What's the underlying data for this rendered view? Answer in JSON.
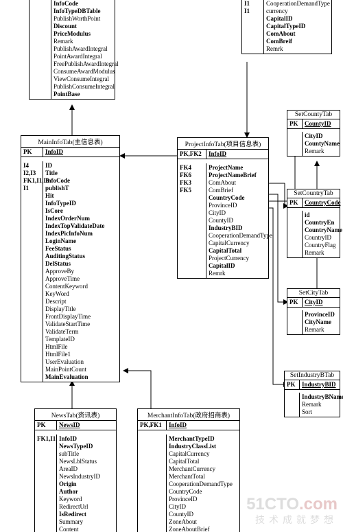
{
  "watermark": {
    "logo_a": "51CTO",
    "logo_b": ".com",
    "sub": "技术成就梦想"
  },
  "tables": {
    "topLeft": {
      "pk": "",
      "fields": [
        {
          "t": "InfoCode",
          "b": true
        },
        {
          "t": "InfoTypeDBTable",
          "b": true
        },
        {
          "t": "PublishWorthPoint",
          "b": false
        },
        {
          "t": "Discount",
          "b": true
        },
        {
          "t": "PriceModulus",
          "b": true
        },
        {
          "t": "Remark",
          "b": false
        },
        {
          "t": "PublishAwardIntegral",
          "b": false
        },
        {
          "t": "PointAwardIntegral",
          "b": false
        },
        {
          "t": "FreePublishAwardIntegral",
          "b": false
        },
        {
          "t": "ConsumeAwardModulus",
          "b": false
        },
        {
          "t": "ViewConsumeIntegral",
          "b": false
        },
        {
          "t": "PublishConsumeIntegral",
          "b": false
        },
        {
          "t": "PointBase",
          "b": true
        }
      ]
    },
    "topRight": {
      "keys": [
        "",
        "",
        "I1",
        "I1"
      ],
      "fields": [
        {
          "t": "CooperationDemandType",
          "b": false
        },
        {
          "t": "currency",
          "b": false
        },
        {
          "t": "CapitalID",
          "b": true
        },
        {
          "t": "CapitalTypeID",
          "b": true
        },
        {
          "t": "ComAbout",
          "b": true
        },
        {
          "t": "ComBreif",
          "b": true
        },
        {
          "t": "Remrk",
          "b": false
        }
      ]
    },
    "mainInfo": {
      "title": "MainInfoTab(主信息表)",
      "pkLabel": "PK",
      "pkField": "InfoID",
      "keys": [
        "",
        "",
        "",
        "",
        "I4",
        "I2,I3",
        "",
        "FK1,I1,I3",
        "",
        "",
        "",
        "",
        "",
        "I1"
      ],
      "fields": [
        {
          "t": "ID",
          "b": true
        },
        {
          "t": "Title",
          "b": true
        },
        {
          "t": "InfoCode",
          "b": true
        },
        {
          "t": "publishT",
          "b": true
        },
        {
          "t": "Hit",
          "b": true
        },
        {
          "t": "InfoTypeID",
          "b": true
        },
        {
          "t": "IsCore",
          "b": true
        },
        {
          "t": "IndexOrderNum",
          "b": true
        },
        {
          "t": "IndexTopValidateDate",
          "b": true
        },
        {
          "t": "IndexPicInfoNum",
          "b": true
        },
        {
          "t": "LoginName",
          "b": true
        },
        {
          "t": "FeeStatus",
          "b": true
        },
        {
          "t": "AuditingStatus",
          "b": true
        },
        {
          "t": "DelStatus",
          "b": true
        },
        {
          "t": "ApproveBy",
          "b": false
        },
        {
          "t": "ApproveTime",
          "b": false
        },
        {
          "t": "ContentKeyword",
          "b": false
        },
        {
          "t": "KeyWord",
          "b": false
        },
        {
          "t": "Descript",
          "b": false
        },
        {
          "t": "DisplayTitle",
          "b": false
        },
        {
          "t": "FrontDisplayTime",
          "b": false
        },
        {
          "t": "ValidateStartTime",
          "b": false
        },
        {
          "t": "ValidateTerm",
          "b": false
        },
        {
          "t": "TemplateID",
          "b": false
        },
        {
          "t": "HtmlFile",
          "b": false
        },
        {
          "t": "HtmlFile1",
          "b": false
        },
        {
          "t": "UserEvaluation",
          "b": false
        },
        {
          "t": "MainPointCount",
          "b": false
        },
        {
          "t": "MainEvaluation",
          "b": true
        }
      ]
    },
    "projectInfo": {
      "title": "ProjectInfoTab(项目信息表)",
      "pkLabel": "PK,FK2",
      "pkField": "InfoID",
      "keys": [
        "",
        "",
        "",
        "",
        "FK4",
        "",
        "FK6",
        "FK3",
        "FK5"
      ],
      "fields": [
        {
          "t": "ProjectName",
          "b": true
        },
        {
          "t": "ProjectNameBrief",
          "b": true
        },
        {
          "t": "ComAbout",
          "b": false
        },
        {
          "t": "ComBrief",
          "b": false
        },
        {
          "t": "CountryCode",
          "b": true
        },
        {
          "t": "ProvinceID",
          "b": false
        },
        {
          "t": "CityID",
          "b": false
        },
        {
          "t": "CountyID",
          "b": false
        },
        {
          "t": "IndustryBID",
          "b": true
        },
        {
          "t": "CooperationDemandType",
          "b": false
        },
        {
          "t": "CapitalCurrency",
          "b": false
        },
        {
          "t": "CapitalTotal",
          "b": true
        },
        {
          "t": "ProjectCurrency",
          "b": false
        },
        {
          "t": "CapitalID",
          "b": true
        },
        {
          "t": "Remrk",
          "b": false
        }
      ]
    },
    "setCounty": {
      "title": "SetCountyTab",
      "pkLabel": "PK",
      "pkField": "CountyID",
      "fields": [
        {
          "t": "CityID",
          "b": true
        },
        {
          "t": "CountyName",
          "b": true
        },
        {
          "t": "Remark",
          "b": false
        }
      ]
    },
    "setCountry": {
      "title": "SetCountryTab",
      "pkLabel": "PK",
      "pkField": "CountryCode",
      "fields": [
        {
          "t": "id",
          "b": true
        },
        {
          "t": "CountryEn",
          "b": true
        },
        {
          "t": "CountryName",
          "b": true
        },
        {
          "t": "CountryID",
          "b": false
        },
        {
          "t": "CountryFlag",
          "b": false
        },
        {
          "t": "Remark",
          "b": false
        }
      ]
    },
    "setCity": {
      "title": "SetCityTab",
      "pkLabel": "PK",
      "pkField": "CityID",
      "fields": [
        {
          "t": "ProvinceID",
          "b": true
        },
        {
          "t": "CityName",
          "b": true
        },
        {
          "t": "Remark",
          "b": false
        }
      ]
    },
    "setIndustryB": {
      "title": "SetIndustryBTab",
      "pkLabel": "PK",
      "pkField": "IndustryBID",
      "fields": [
        {
          "t": "IndustryBName",
          "b": true
        },
        {
          "t": "Remark",
          "b": false
        },
        {
          "t": "Sort",
          "b": false
        }
      ]
    },
    "news": {
      "title": "NewsTab(资讯表)",
      "pkLabel": "PK",
      "pkField": "NewsID",
      "keys": [
        "",
        "FK1,I1"
      ],
      "fields": [
        {
          "t": "InfoID",
          "b": true
        },
        {
          "t": "NewsTypeID",
          "b": true
        },
        {
          "t": "subTitle",
          "b": false
        },
        {
          "t": "NewsLblStatus",
          "b": false
        },
        {
          "t": "AreaID",
          "b": false
        },
        {
          "t": "NewsIndustryID",
          "b": false
        },
        {
          "t": "Origin",
          "b": true
        },
        {
          "t": "Author",
          "b": true
        },
        {
          "t": "Keyword",
          "b": false
        },
        {
          "t": "RedirectUrl",
          "b": false
        },
        {
          "t": "IsRedirect",
          "b": true
        },
        {
          "t": "Summary",
          "b": false
        },
        {
          "t": "Content",
          "b": false
        }
      ]
    },
    "merchant": {
      "title": "MerchantInfoTab(政府招商表)",
      "pkLabel": "PK,FK1",
      "pkField": "InfoID",
      "fields": [
        {
          "t": "MerchantTypeID",
          "b": true
        },
        {
          "t": "IndustryClassList",
          "b": true
        },
        {
          "t": "CapitalCurrency",
          "b": false
        },
        {
          "t": "CapitalTotal",
          "b": false
        },
        {
          "t": "MerchantCurrency",
          "b": false
        },
        {
          "t": "MerchantTotal",
          "b": false
        },
        {
          "t": "CooperationDemandType",
          "b": false
        },
        {
          "t": "CountryCode",
          "b": false
        },
        {
          "t": "ProvinceID",
          "b": false
        },
        {
          "t": "CityID",
          "b": false
        },
        {
          "t": "CountyID",
          "b": false
        },
        {
          "t": "ZoneAbout",
          "b": false
        },
        {
          "t": "ZoneAboutBrief",
          "b": false
        }
      ]
    }
  }
}
